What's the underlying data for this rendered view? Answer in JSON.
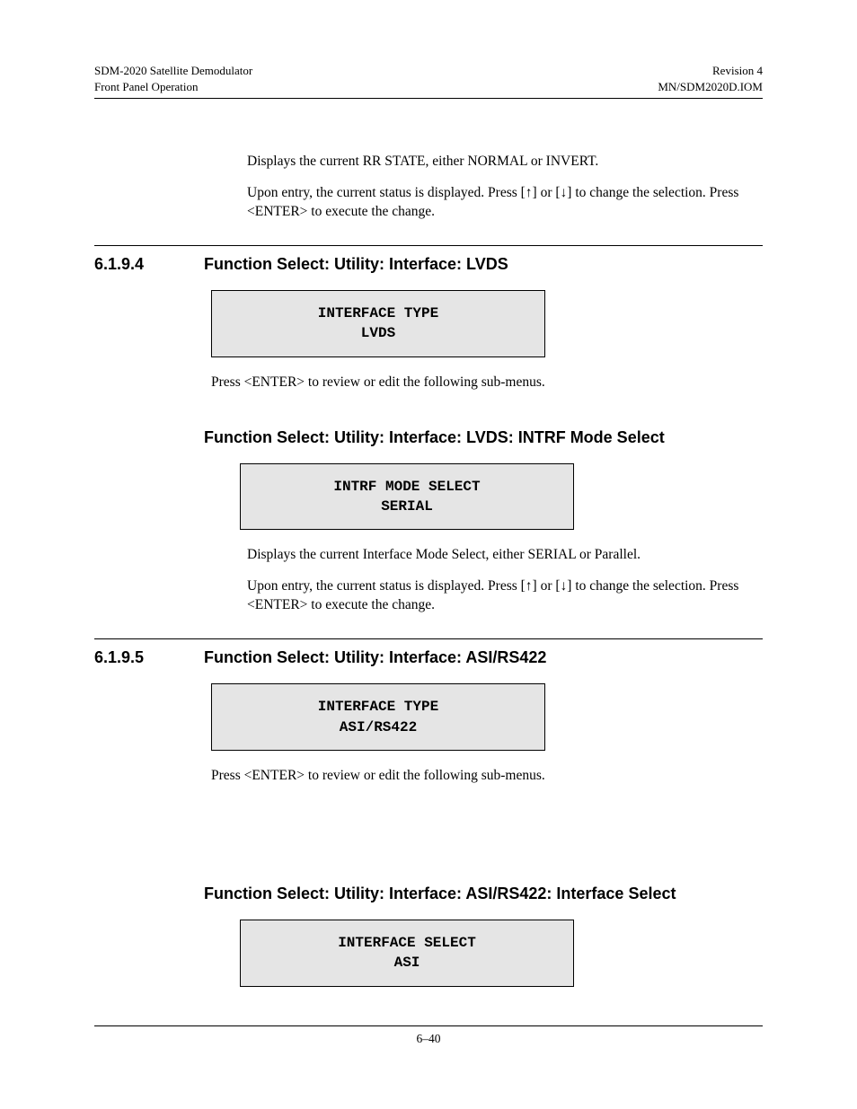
{
  "header": {
    "leftLine1": "SDM-2020 Satellite Demodulator",
    "leftLine2": "Front Panel Operation",
    "rightLine1": "Revision 4",
    "rightLine2": "MN/SDM2020D.IOM"
  },
  "intro": {
    "p1": "Displays the current RR STATE, either NORMAL or INVERT.",
    "p2a": "Upon entry, the current status is displayed. Press [",
    "up": "↑",
    "p2b": "] or [",
    "down": "↓",
    "p2c": "] to change the selection. Press <ENTER> to execute the change."
  },
  "sec1": {
    "num": "6.1.9.4",
    "title": "Function Select: Utility: Interface: LVDS",
    "boxL1": "INTERFACE TYPE",
    "boxL2": "LVDS",
    "after": "Press <ENTER> to review or edit the following sub-menus.",
    "sub": {
      "title": "Function Select: Utility: Interface: LVDS: INTRF Mode Select",
      "boxL1": "INTRF MODE SELECT",
      "boxL2": "SERIAL",
      "p1": "Displays the current Interface Mode Select, either SERIAL or Parallel.",
      "p2a": "Upon entry, the current status is displayed. Press [",
      "up": "↑",
      "p2b": "] or [",
      "down": "↓",
      "p2c": "] to change the selection. Press <ENTER> to execute the change."
    }
  },
  "sec2": {
    "num": "6.1.9.5",
    "title": "Function Select: Utility: Interface: ASI/RS422",
    "boxL1": "INTERFACE TYPE",
    "boxL2": "ASI/RS422",
    "after": "Press <ENTER> to review or edit the following sub-menus.",
    "sub": {
      "title": "Function Select: Utility: Interface: ASI/RS422: Interface Select",
      "boxL1": "INTERFACE SELECT",
      "boxL2": "ASI"
    }
  },
  "footer": {
    "page": "6–40"
  }
}
